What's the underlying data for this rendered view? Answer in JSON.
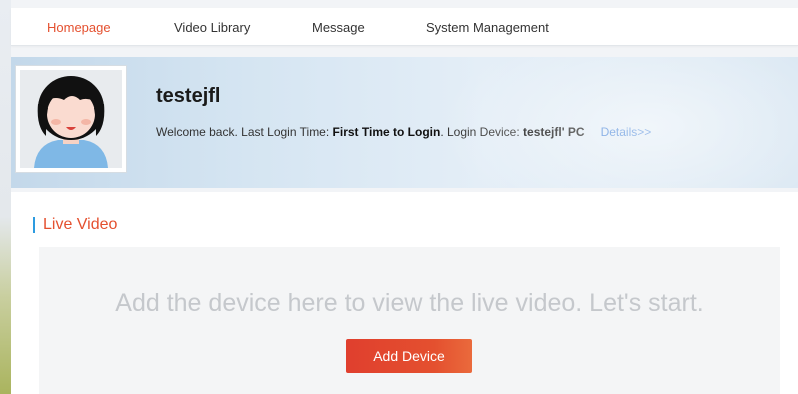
{
  "nav": {
    "items": [
      {
        "label": "Homepage",
        "active": true
      },
      {
        "label": "Video Library",
        "active": false
      },
      {
        "label": "Message",
        "active": false
      },
      {
        "label": "System Management",
        "active": false
      }
    ]
  },
  "profile": {
    "username": "testejfl",
    "welcome_prefix": "Welcome back. Last Login Time: ",
    "last_login_time": "First Time to Login",
    "device_prefix": ". Login Device: ",
    "login_device": "testejfl' PC",
    "details_link": "Details>>",
    "avatar_icon": "user-avatar-icon"
  },
  "live_video": {
    "title": "Live Video",
    "empty_message": "Add the device here to view the live video. Let's start.",
    "add_button_label": "Add Device"
  },
  "colors": {
    "accent": "#e4502f",
    "link": "#3a7bd5",
    "title_marker": "#2d9be0"
  }
}
